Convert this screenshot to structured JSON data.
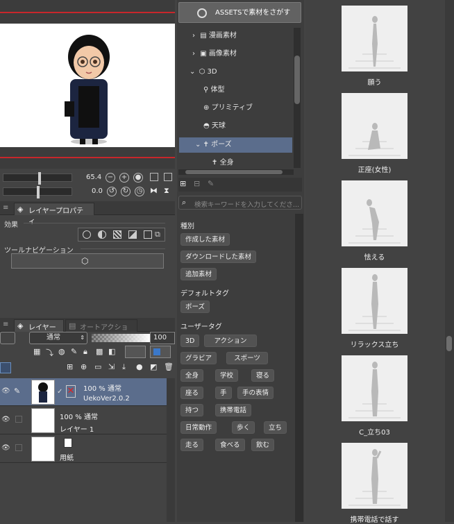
{
  "navigator": {
    "zoom_value": "65.4",
    "rotate_value": "0.0"
  },
  "properties_panel": {
    "tab_label": "レイヤープロパティ",
    "effect_label": "効果",
    "tool_nav_label": "ツールナビゲーション"
  },
  "layers_panel": {
    "tabs": [
      {
        "label": "レイヤー"
      },
      {
        "label": "オートアクション"
      }
    ],
    "blend_mode": "通常",
    "opacity": "100",
    "layers": [
      {
        "line1": "100 % 通常",
        "line2": "UekoVer2.0.2"
      },
      {
        "line1": "100 % 通常",
        "line2": "レイヤー 1"
      },
      {
        "line1": "",
        "line2": "用紙"
      }
    ]
  },
  "materials": {
    "assets_button": "ASSETSで素材をさがす",
    "tree": [
      {
        "label": "漫画素材"
      },
      {
        "label": "画像素材"
      },
      {
        "label": "3D"
      },
      {
        "label": "体型"
      },
      {
        "label": "プリミティブ"
      },
      {
        "label": "天球"
      },
      {
        "label": "ポーズ"
      },
      {
        "label": "全身"
      }
    ],
    "search_placeholder": "検索キーワードを入力してくださ...",
    "categories": {
      "kind_title": "種別",
      "kind_tags": [
        "作成した素材",
        "ダウンロードした素材",
        "追加素材"
      ],
      "default_title": "デフォルトタグ",
      "default_tags": [
        "ポーズ"
      ],
      "user_title": "ユーザータグ",
      "user_tags": [
        "3D",
        "アクション",
        "グラビア",
        "スポーツ",
        "全身",
        "学校",
        "寝る",
        "座る",
        "手",
        "手の表情",
        "持つ",
        "携帯電話",
        "日常動作",
        "歩く",
        "立ち",
        "走る",
        "食べる",
        "飲む"
      ]
    }
  },
  "pose_list": [
    {
      "label": "願う"
    },
    {
      "label": "正座(女性)"
    },
    {
      "label": "怯える"
    },
    {
      "label": "リラックス立ち"
    },
    {
      "label": "C_立ち03"
    },
    {
      "label": "携帯電話で話す"
    }
  ],
  "colors": {
    "accent_red": "#c8262b",
    "selection_blue": "#5b6d8c",
    "panel_bg": "#434343"
  }
}
